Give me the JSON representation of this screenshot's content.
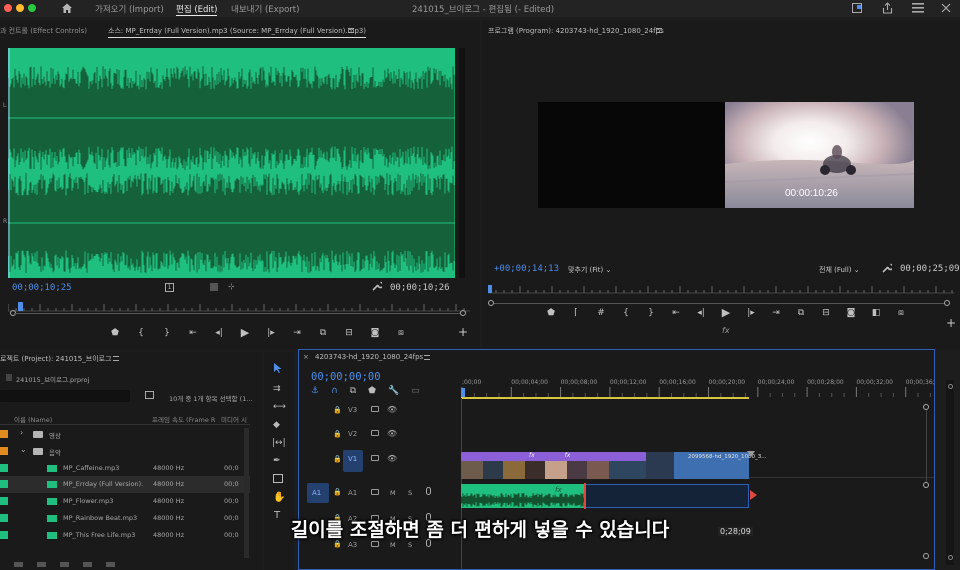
{
  "menu": {
    "home_icon": "home-icon",
    "import": "가져오기 (Import)",
    "edit": "편집 (Edit)",
    "export": "내보내기 (Export)",
    "title": "241015_브이로그 - 편집됨 (- Edited)"
  },
  "source": {
    "tab_effects": "과 컨트롤 (Effect Controls)",
    "tab_source": "소스: MP_Errday (Full Version).mp3 (Source: MP_Errday (Full Version).mp3)",
    "channel_l": "L",
    "channel_r": "R",
    "timecode_left": "00;00;10;25",
    "timecode_right": "00;00;10;26",
    "accent": "#1fc07f"
  },
  "program": {
    "title": "프로그램 (Program): 4203743-hd_1920_1080_24fps",
    "overlay_timecode": "00:00:10:26",
    "timecode_left": "+00;00;14;13",
    "fit": "맞추기 (Fit)",
    "quality": "전체 (Full)",
    "timecode_right": "00;00;25;09"
  },
  "project": {
    "title": "로젝트 (Project): 241015_브이로그",
    "file": "241015_브이로그.prproj",
    "selection_info": "10개 중 1개 항목 선택함 (1...",
    "col_name": "이름 (Name)",
    "col_framerate": "프레임 속도 (Frame R",
    "col_media": "미디어 시",
    "items": [
      {
        "label": "영상",
        "type": "folder",
        "rate": "",
        "media": "",
        "color": "#e08a1f",
        "indent": 0,
        "arrow": "›"
      },
      {
        "label": "음악",
        "type": "folder",
        "rate": "",
        "media": "",
        "color": "#e08a1f",
        "indent": 0,
        "arrow": "⌄"
      },
      {
        "label": "MP_Caffeine.mp3",
        "type": "audio",
        "rate": "48000 Hz",
        "media": "00;0",
        "color": "#1fc07f",
        "indent": 1,
        "arrow": ""
      },
      {
        "label": "MP_Errday (Full Version).",
        "type": "audio",
        "rate": "48000 Hz",
        "media": "00;0",
        "color": "#1fc07f",
        "indent": 1,
        "arrow": "",
        "selected": true
      },
      {
        "label": "MP_Flower.mp3",
        "type": "audio",
        "rate": "48000 Hz",
        "media": "00;0",
        "color": "#1fc07f",
        "indent": 1,
        "arrow": ""
      },
      {
        "label": "MP_Rainbow Beat.mp3",
        "type": "audio",
        "rate": "48000 Hz",
        "media": "00;0",
        "color": "#1fc07f",
        "indent": 1,
        "arrow": ""
      },
      {
        "label": "MP_This Free Life.mp3",
        "type": "audio",
        "rate": "48000 Hz",
        "media": "00;0",
        "color": "#1fc07f",
        "indent": 1,
        "arrow": ""
      }
    ]
  },
  "timeline": {
    "title": "4203743-hd_1920_1080_24fps",
    "timecode": "00;00;00;00",
    "ruler": [
      ";00;00",
      "00;00;04;00",
      "00;00;08;00",
      "00;00;12;00",
      "00;00;16;00",
      "00;00;20;00",
      "00;00;24;00",
      "00;00;28;00",
      "00;00;32;00",
      "00;00;36;00",
      "00;00;40"
    ],
    "video_tracks": [
      "V3",
      "V2",
      "V1"
    ],
    "audio_tracks": [
      "A1",
      "A2",
      "A3"
    ],
    "source_patch_a1": "A1",
    "mute_label": "M",
    "solo_label": "S",
    "clip_label": "2099568-hd_1920_1080_3...",
    "fx_label": "fx",
    "tooltip_partial": "0;28;09",
    "video_clip_color": "#8b5fd8",
    "video_clip2_color": "#3e6fb0",
    "audio_clip_color": "#1fc07f"
  },
  "subtitle": "길이를 조절하면 좀 더 편하게 넣을 수 있습니다"
}
